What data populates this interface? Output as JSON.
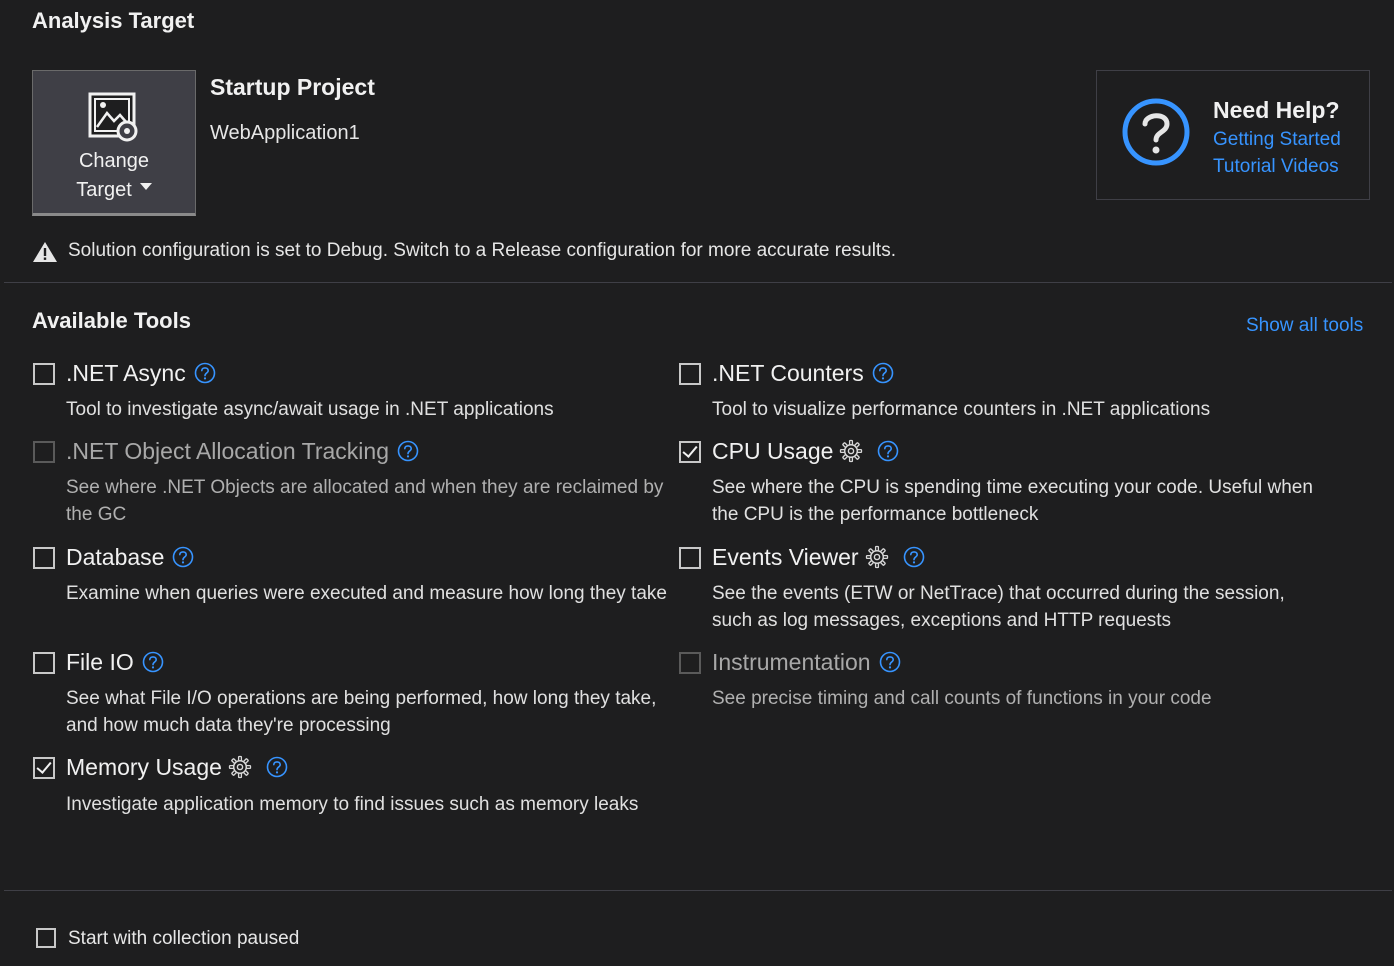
{
  "analysis_target": {
    "title": "Analysis Target",
    "change_target_line1": "Change",
    "change_target_line2": "Target",
    "project_heading": "Startup Project",
    "project_name": "WebApplication1"
  },
  "help": {
    "title": "Need Help?",
    "link1": "Getting Started",
    "link2": "Tutorial Videos"
  },
  "warning": "Solution configuration is set to Debug. Switch to a Release configuration for more accurate results.",
  "tools": {
    "title": "Available Tools",
    "show_all": "Show all tools",
    "items": [
      {
        "name": ".NET Async",
        "desc": "Tool to investigate async/await usage in .NET applications",
        "checked": false,
        "enabled": true,
        "settings": false
      },
      {
        "name": ".NET Counters",
        "desc": "Tool to visualize performance counters in .NET applications",
        "checked": false,
        "enabled": true,
        "settings": false
      },
      {
        "name": ".NET Object Allocation Tracking",
        "desc": "See where .NET Objects are allocated and when they are reclaimed by the GC",
        "checked": false,
        "enabled": false,
        "settings": false
      },
      {
        "name": "CPU Usage",
        "desc": "See where the CPU is spending time executing your code. Useful when the CPU is the performance bottleneck",
        "checked": true,
        "enabled": true,
        "settings": true
      },
      {
        "name": "Database",
        "desc": "Examine when queries were executed and measure how long they take",
        "checked": false,
        "enabled": true,
        "settings": false
      },
      {
        "name": "Events Viewer",
        "desc": "See the events (ETW or NetTrace) that occurred during the session, such as log messages, exceptions and HTTP requests",
        "checked": false,
        "enabled": true,
        "settings": true
      },
      {
        "name": "File IO",
        "desc": "See what File I/O operations are being performed, how long they take, and how much data they're processing",
        "checked": false,
        "enabled": true,
        "settings": false
      },
      {
        "name": "Instrumentation",
        "desc": "See precise timing and call counts of functions in your code",
        "checked": false,
        "enabled": false,
        "settings": false
      },
      {
        "name": "Memory Usage",
        "desc": "Investigate application memory to find issues such as memory leaks",
        "checked": true,
        "enabled": true,
        "settings": true
      }
    ]
  },
  "footer": {
    "start_paused": "Start with collection paused",
    "start_paused_checked": false
  },
  "colors": {
    "background": "#1e1e1f",
    "link": "#3794ff",
    "help_icon": "#3794ff"
  }
}
